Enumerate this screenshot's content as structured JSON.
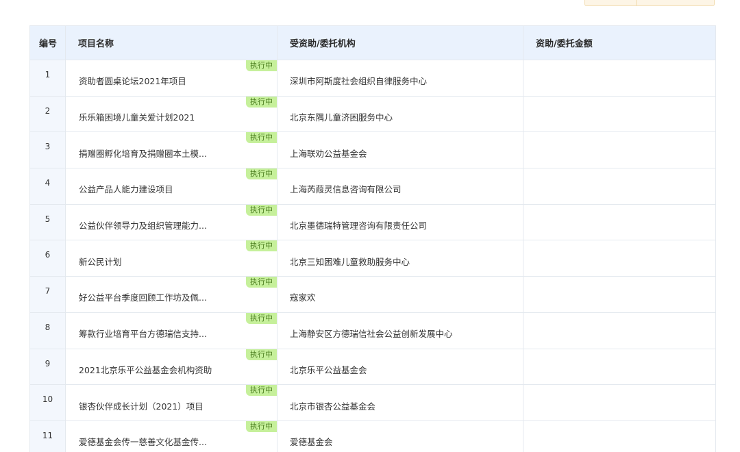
{
  "table": {
    "columns": [
      "编号",
      "项目名称",
      "受资助/委托机构",
      "资助/委托金额"
    ],
    "rows": [
      {
        "no": "1",
        "name": "资助者圆桌论坛2021年项目",
        "status": "执行中",
        "org": "深圳市阿斯度社会组织自律服务中心",
        "amount": ""
      },
      {
        "no": "2",
        "name": "乐乐箱困境儿童关爱计划2021",
        "status": "执行中",
        "org": "北京东隅儿童济困服务中心",
        "amount": ""
      },
      {
        "no": "3",
        "name": "捐赠圈孵化培育及捐赠圈本土模...",
        "status": "执行中",
        "org": "上海联劝公益基金会",
        "amount": ""
      },
      {
        "no": "4",
        "name": "公益产品人能力建设项目",
        "status": "执行中",
        "org": "上海芮葭灵信息咨询有限公司",
        "amount": ""
      },
      {
        "no": "5",
        "name": "公益伙伴领导力及组织管理能力...",
        "status": "执行中",
        "org": "北京墨德瑞特管理咨询有限责任公司",
        "amount": ""
      },
      {
        "no": "6",
        "name": "新公民计划",
        "status": "执行中",
        "org": "北京三知困难儿童救助服务中心",
        "amount": ""
      },
      {
        "no": "7",
        "name": "好公益平台季度回顾工作坊及佩...",
        "status": "执行中",
        "org": "寇家欢",
        "amount": ""
      },
      {
        "no": "8",
        "name": "筹款行业培育平台方德瑞信支持...",
        "status": "执行中",
        "org": "上海静安区方德瑞信社会公益创新发展中心",
        "amount": ""
      },
      {
        "no": "9",
        "name": "2021北京乐平公益基金会机构资助",
        "status": "执行中",
        "org": "北京乐平公益基金会",
        "amount": ""
      },
      {
        "no": "10",
        "name": "银杏伙伴成长计划（2021）项目",
        "status": "执行中",
        "org": "北京市银杏公益基金会",
        "amount": ""
      },
      {
        "no": "11",
        "name": "爱德基金会传一慈善文化基金传...",
        "status": "执行中",
        "org": "爱德基金会",
        "amount": ""
      }
    ]
  },
  "colors": {
    "header_bg": "#eaf2fd",
    "number_col_bg": "#f3f7fd",
    "status_tag_bg": "#c6f09b",
    "status_tag_text": "#4a7d1e",
    "border": "#e4e9ef"
  }
}
